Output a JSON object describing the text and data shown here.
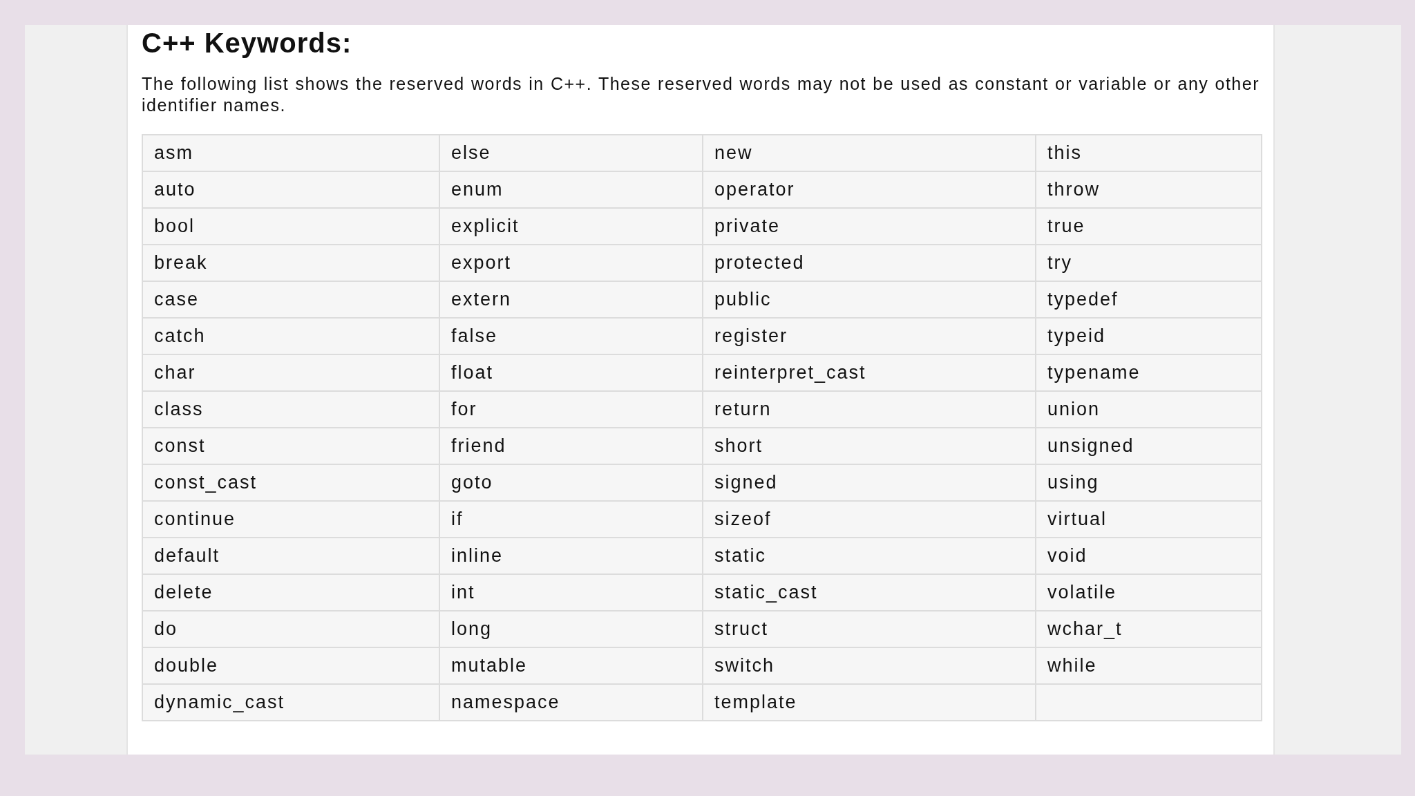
{
  "heading": "C++ Keywords:",
  "intro": "The following list shows the reserved words in C++. These reserved words may not be used as constant or variable or any other identifier names.",
  "table": {
    "rows": [
      [
        "asm",
        "else",
        "new",
        "this"
      ],
      [
        "auto",
        "enum",
        "operator",
        "throw"
      ],
      [
        "bool",
        "explicit",
        "private",
        "true"
      ],
      [
        "break",
        "export",
        "protected",
        "try"
      ],
      [
        "case",
        "extern",
        "public",
        "typedef"
      ],
      [
        "catch",
        "false",
        "register",
        "typeid"
      ],
      [
        "char",
        "float",
        "reinterpret_cast",
        "typename"
      ],
      [
        "class",
        "for",
        "return",
        "union"
      ],
      [
        "const",
        "friend",
        "short",
        "unsigned"
      ],
      [
        "const_cast",
        "goto",
        "signed",
        "using"
      ],
      [
        "continue",
        "if",
        "sizeof",
        "virtual"
      ],
      [
        "default",
        "inline",
        "static",
        "void"
      ],
      [
        "delete",
        "int",
        "static_cast",
        "volatile"
      ],
      [
        "do",
        "long",
        "struct",
        "wchar_t"
      ],
      [
        "double",
        "mutable",
        "switch",
        "while"
      ],
      [
        "dynamic_cast",
        "namespace",
        "template"
      ]
    ]
  }
}
